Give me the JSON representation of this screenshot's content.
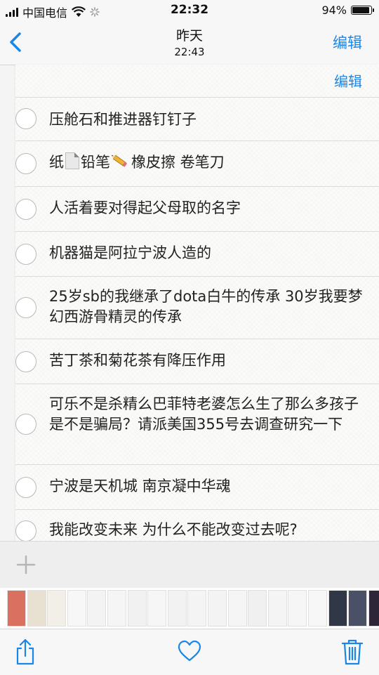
{
  "status_bar": {
    "carrier": "中国电信",
    "time": "22:32",
    "battery_percent": "94%",
    "battery_level": 0.94
  },
  "nav": {
    "back_icon": "chevron-left-icon",
    "title": "昨天",
    "subtitle": "22:43",
    "edit_label": "编辑"
  },
  "list": {
    "edit_label": "编辑",
    "items": [
      {
        "segments": [
          "压舱石和推进器钉钉子"
        ]
      },
      {
        "segments": [
          "纸",
          "[doc]",
          "铅笔",
          "[pencil]",
          "橡皮擦 卷笔刀"
        ]
      },
      {
        "segments": [
          "人活着要对得起父母取的名字"
        ]
      },
      {
        "segments": [
          "机器猫是阿拉宁波人造的"
        ]
      },
      {
        "segments": [
          "25岁sb的我继承了dota白牛的传承 30岁我要梦幻西游骨精灵的传承"
        ]
      },
      {
        "segments": [
          "苦丁茶和菊花茶有降压作用"
        ]
      },
      {
        "segments": [
          "可乐不是杀精么巴菲特老婆怎么生了那么多孩子是不是骗局？请派美国355号去调查研究一下"
        ]
      },
      {
        "segments": [
          "宁波是天机城 南京凝中华魂"
        ]
      },
      {
        "segments": [
          "我能改变未来 为什么不能改变过去呢?"
        ]
      }
    ]
  },
  "add_bar": {
    "icon": "plus-icon"
  },
  "thumbnails": {
    "count": 20
  },
  "toolbar": {
    "share_icon": "share-icon",
    "like_icon": "heart-icon",
    "delete_icon": "trash-icon"
  },
  "colors": {
    "accent": "#1a86e8",
    "text": "#222222",
    "divider": "#dcdcdc"
  }
}
